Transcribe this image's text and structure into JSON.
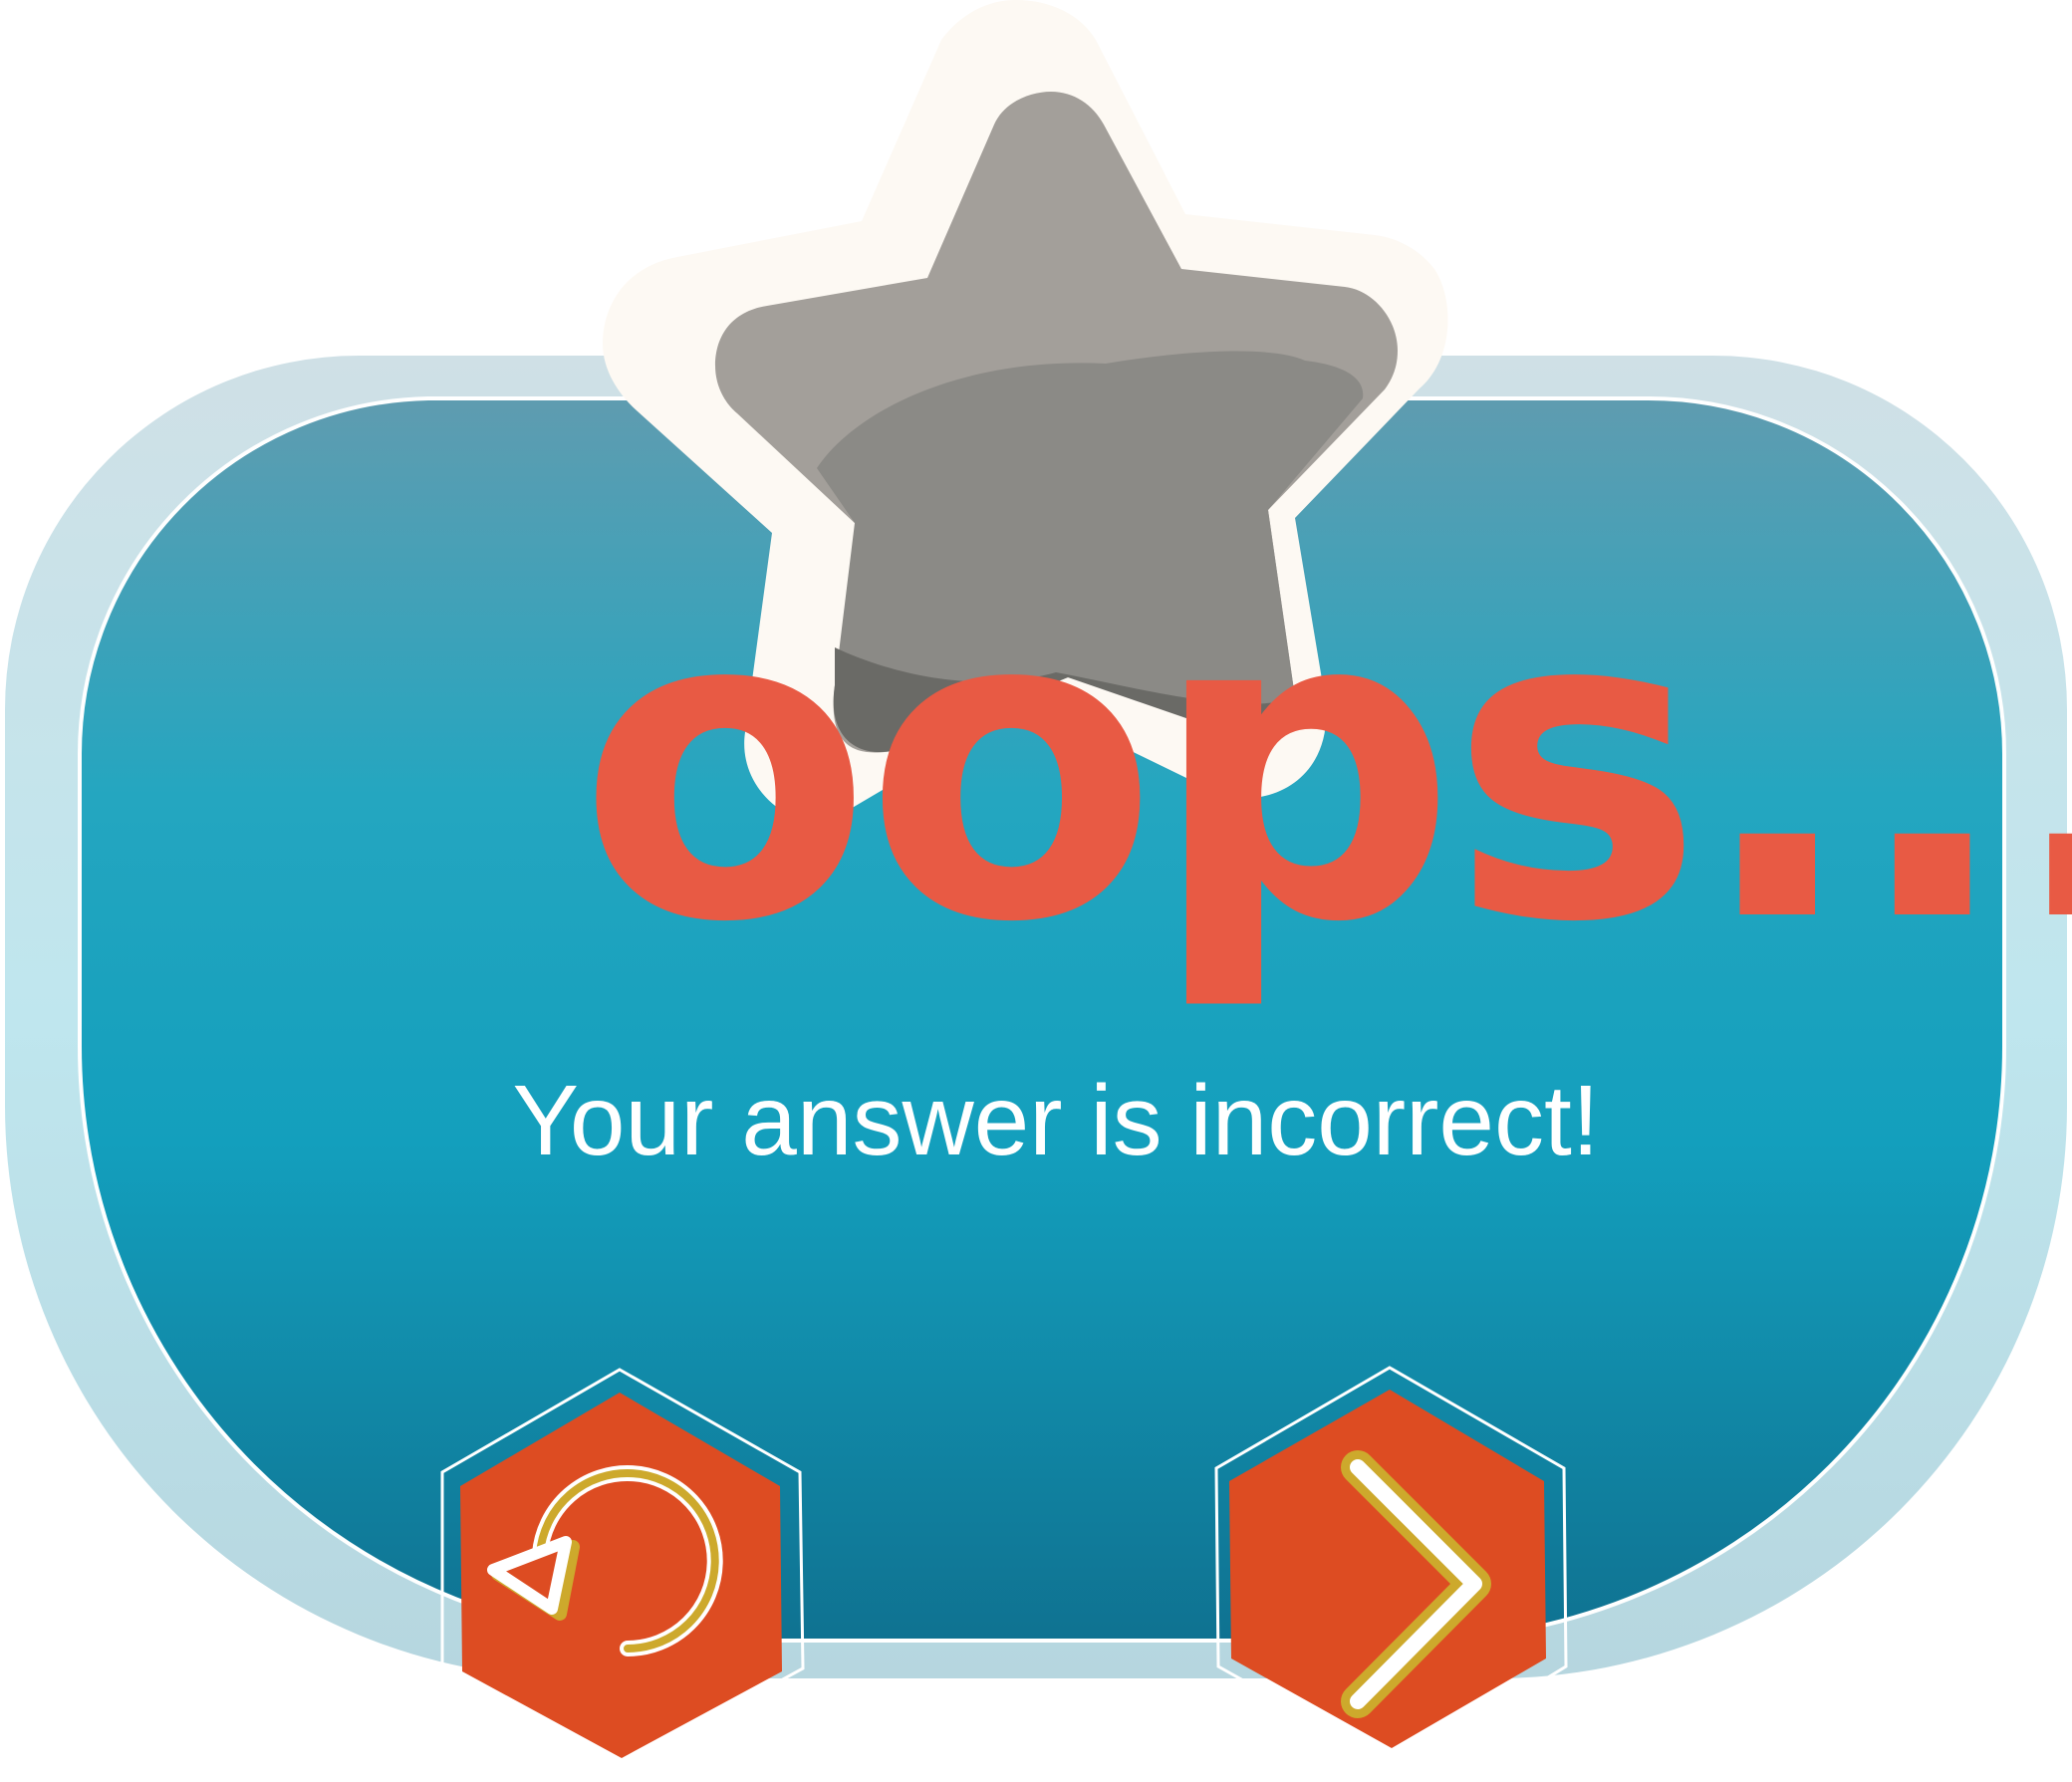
{
  "dialog": {
    "title": "oops...",
    "message": "Your answer is incorrect!"
  },
  "buttons": {
    "retry": {
      "icon": "retry-icon"
    },
    "next": {
      "icon": "chevron-right-icon"
    }
  },
  "colors": {
    "panel_outer": "#cde1e8",
    "panel_top": "#5f9cb0",
    "panel_mid": "#12a3c0",
    "panel_bottom": "#0f7291",
    "star_fill": "#a39f9a",
    "star_shadow": "#8b8a86",
    "star_outline": "#fdf9f3",
    "title": "#e85a44",
    "button_fill": "#dd4c22",
    "button_accent": "#cda92c"
  }
}
